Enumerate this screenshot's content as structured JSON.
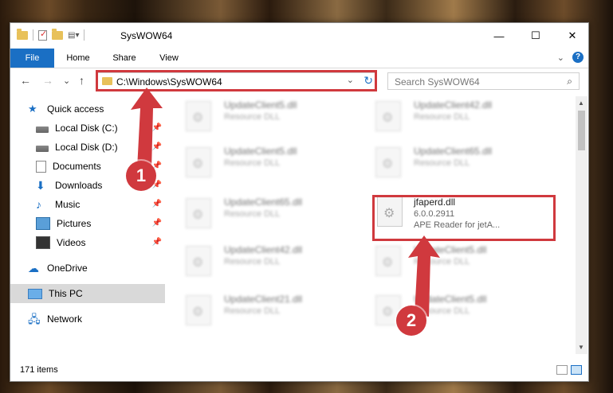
{
  "window": {
    "title": "SysWOW64",
    "controls": {
      "minimize": "—",
      "maximize": "☐",
      "close": "✕"
    }
  },
  "ribbon": {
    "tabs": [
      {
        "label": "File"
      },
      {
        "label": "Home"
      },
      {
        "label": "Share"
      },
      {
        "label": "View"
      }
    ],
    "help": "?"
  },
  "nav": {
    "back": "←",
    "forward": "→",
    "recent": "⌄",
    "up": "↑",
    "address": "C:\\Windows\\SysWOW64",
    "search_placeholder": "Search SysWOW64"
  },
  "sidebar": {
    "items": [
      {
        "label": "Quick access",
        "icon": "star-icon"
      },
      {
        "label": "Local Disk (C:)",
        "icon": "drive-icon",
        "pinned": true
      },
      {
        "label": "Local Disk (D:)",
        "icon": "drive-icon",
        "pinned": true
      },
      {
        "label": "Documents",
        "icon": "documents-icon",
        "pinned": true
      },
      {
        "label": "Downloads",
        "icon": "downloads-icon",
        "pinned": true
      },
      {
        "label": "Music",
        "icon": "music-icon",
        "pinned": true
      },
      {
        "label": "Pictures",
        "icon": "pictures-icon",
        "pinned": true
      },
      {
        "label": "Videos",
        "icon": "videos-icon",
        "pinned": true
      },
      {
        "label": "OneDrive",
        "icon": "onedrive-icon"
      },
      {
        "label": "This PC",
        "icon": "pc-icon",
        "selected": true
      },
      {
        "label": "Network",
        "icon": "network-icon"
      }
    ]
  },
  "files": {
    "left": [
      {
        "name": "UpdateClient5.dll",
        "type": "Resource DLL"
      },
      {
        "name": "UpdateClient5.dll",
        "type": "Resource DLL"
      },
      {
        "name": "UpdateClient65.dll",
        "type": "Resource DLL"
      },
      {
        "name": "UpdateClient42.dll",
        "type": "Resource DLL"
      },
      {
        "name": "UpdateClient21.dll",
        "type": "Resource DLL"
      }
    ],
    "right": [
      {
        "name": "UpdateClient42.dll",
        "type": "Resource DLL"
      },
      {
        "name": "UpdateClient65.dll",
        "type": "Resource DLL"
      },
      {
        "name": "UpdateClient5.dll",
        "type": "Resource DLL"
      },
      {
        "name": "UpdateClient5.dll",
        "type": "Resource DLL"
      }
    ],
    "featured": {
      "name": "jfaperd.dll",
      "version": "6.0.0.2911",
      "desc": "APE Reader for jetA..."
    }
  },
  "status": {
    "items": "171 items"
  },
  "callouts": {
    "one": "1",
    "two": "2"
  },
  "colors": {
    "accent": "#1a6fc4",
    "highlight": "#d0393e"
  }
}
